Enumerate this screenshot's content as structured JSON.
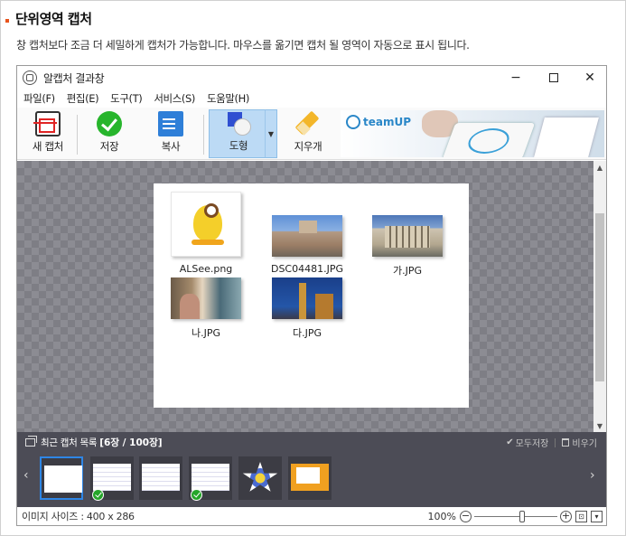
{
  "section": {
    "title": "단위영역 캡처",
    "description": "창 캡처보다 조금 더 세밀하게 캡처가 가능합니다. 마우스를 옮기면 캡처 될 영역이 자동으로 표시 됩니다."
  },
  "window": {
    "title": "알캡처 결과창",
    "controls": {
      "minimize": "−",
      "close": "✕"
    }
  },
  "menu": [
    "파일(F)",
    "편집(E)",
    "도구(T)",
    "서비스(S)",
    "도움말(H)"
  ],
  "toolbar": {
    "new_capture": "새 캡처",
    "save": "저장",
    "copy": "복사",
    "shape": "도형",
    "shape_dropdown": "▼",
    "eraser": "지우개"
  },
  "banner": {
    "logo_text": "teamUP"
  },
  "canvas": {
    "items": [
      {
        "name": "ALSee.png"
      },
      {
        "name": "DSC04481.JPG"
      },
      {
        "name": "가.JPG"
      },
      {
        "name": "나.JPG"
      },
      {
        "name": "다.JPG"
      }
    ],
    "scroll_up": "▲",
    "scroll_down": "▼"
  },
  "recent": {
    "title": "최근 캡처 목록",
    "count": "[6장 / 100장]",
    "save_all": "모두저장",
    "clear": "비우기",
    "prev": "‹",
    "next": "›",
    "check_mark": "✔"
  },
  "status": {
    "image_size": "이미지 사이즈 : 400 x 286",
    "zoom": "100%",
    "zoom_out": "−",
    "zoom_in": "+",
    "fit": "⊡",
    "more": "▾"
  },
  "colors": {
    "accent_bullet": "#e8541c",
    "selected_tool": "#bcdaf5",
    "recent_bar": "#4c4c56",
    "selected_thumb_border": "#2e86e6",
    "saved_badge": "#25a52a"
  }
}
